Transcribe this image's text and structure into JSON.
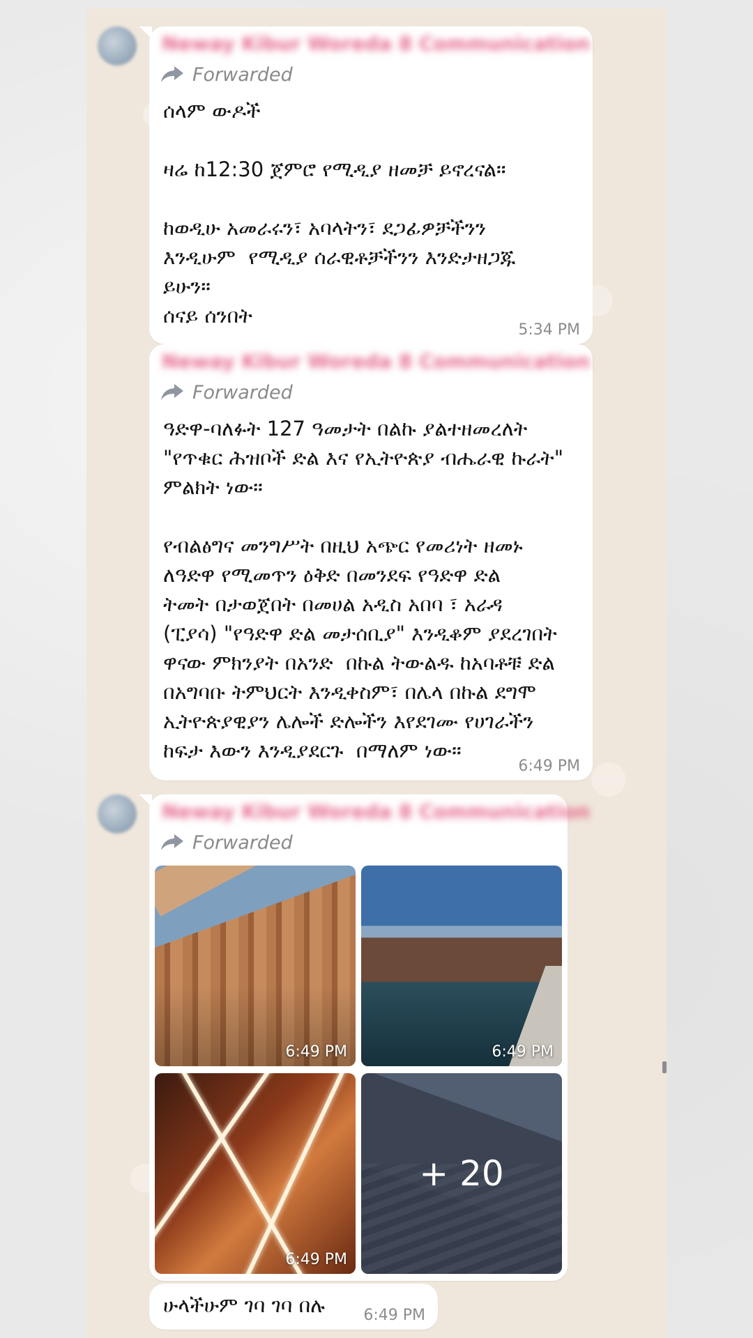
{
  "messages": [
    {
      "sender": "Neway Kibur Woreda 8 Communication",
      "forwarded_label": "Forwarded",
      "text": "ሰላም ውዶች\n\nዛሬ ከ12:30 ጀምሮ የሚዲያ ዘመቻ ይኖረናል።\n\nከወዲሁ አመራሩን፣ አባላትን፣ ደጋፊዎቻችንን\nእንዲሁም  የሚዲያ ሰራዊቶቻችንን እንድታዘጋጁ\nይሁን።\nሰናይ ሰንበት",
      "time": "5:34 PM"
    },
    {
      "sender": "Neway Kibur Woreda 8 Communication",
      "forwarded_label": "Forwarded",
      "text": "ዓድዋ-ባለፉት 127 ዓመታት በልኩ ያልተዘመረለት\n\"የጥቁር ሕዝቦች ድል እና የኢትዮጵያ ብሔራዊ ኩራት\"\nምልክት ነው።\n\nየብልፅግና መንግሥት በዚህ አጭር የመሪነት ዘመኑ\nለዓድዋ የሚመጥን ዕቅድ በመንደፍ የዓድዋ ድል\nትመት በታወጀበት በመሀል አዲስ አበባ ፣ አራዳ\n(ፒያሳ) \"የዓድዋ ድል መታሰቢያ\" እንዲቆም ያደረገበት\nዋናው ምክንያት በአንድ  በኩል ትውልዱ ከአባቶቹ ድል\nበአግባቡ ትምህርት እንዲቀስም፣ በሌላ በኩል ደግሞ\nኢትዮጵያዊያን ሌሎች ድሎችን እየደገሙ የሀገራችን\nከፍታ እውን እንዲያደርጉ  በማለም ነው።",
      "time": "6:49 PM"
    },
    {
      "sender": "Neway Kibur Woreda 8 Communication",
      "forwarded_label": "Forwarded",
      "photos": [
        {
          "time": "6:49 PM"
        },
        {
          "time": "6:49 PM"
        },
        {
          "time": "6:49 PM"
        },
        {
          "more": "+ 20"
        }
      ]
    },
    {
      "text": "ሁላችሁም ገባ ገባ በሉ",
      "time": "6:49 PM"
    }
  ],
  "icons": {
    "forward": "forward-arrow-icon",
    "avatar": "avatar"
  }
}
